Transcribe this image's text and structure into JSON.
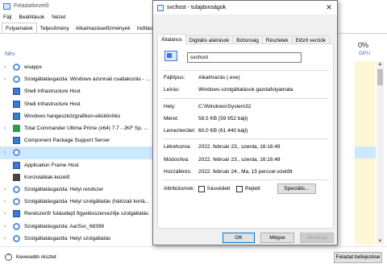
{
  "task_manager": {
    "title": "Feladatkezelő",
    "menu": [
      "Fájl",
      "Beállítások",
      "Nézet"
    ],
    "tabs": [
      "Folyamatok",
      "Teljesítmény",
      "Alkalmazáselőzmények",
      "Indítás"
    ],
    "name_header": "Név",
    "gpu_percent": "0%",
    "gpu_label": "GPU",
    "rows": [
      {
        "name": "wsappx",
        "chev": true,
        "icon": "gear-icon"
      },
      {
        "name": "Szolgáltatásgazda: Windows azonnali csatlakozás - ...",
        "chev": true,
        "icon": "gear-icon"
      },
      {
        "name": "Shell Infrastructure Host",
        "chev": false,
        "icon": "window-icon"
      },
      {
        "name": "Shell Infrastructure Host",
        "chev": false,
        "icon": "window-icon"
      },
      {
        "name": "Windows hangeszközgrafikon-elkülönítés",
        "chev": false,
        "icon": "window-icon"
      },
      {
        "name": "Total Commander Ultima Prime (x64) 7.7 - JKF Sp. ...",
        "chev": true,
        "icon": "app-icon"
      },
      {
        "name": "Component Package Support Server",
        "chev": false,
        "icon": "window-icon"
      },
      {
        "name": "",
        "chev": true,
        "icon": "gear-icon",
        "selected": true
      },
      {
        "name": "Application Frame Host",
        "chev": false,
        "icon": "window-icon"
      },
      {
        "name": "Konzolablak-kezelő",
        "chev": false,
        "icon": "console-icon"
      },
      {
        "name": "Szolgáltatásgazda: Helyi rendszer",
        "chev": true,
        "icon": "gear-icon"
      },
      {
        "name": "Szolgáltatásgazda: Helyi szolgáltatás (hálózati korlá...",
        "chev": true,
        "icon": "gear-icon"
      },
      {
        "name": "Rendszerőr futásidejű figyelésszervezője szolgáltatás",
        "chev": true,
        "icon": "window-icon"
      },
      {
        "name": "Szolgáltatásgazda: AarSvc_68398",
        "chev": true,
        "icon": "gear-icon"
      },
      {
        "name": "Szolgáltatásgazda: Helyi szolgáltatás",
        "chev": true,
        "icon": "gear-icon"
      }
    ],
    "fewer_details": "Kevesebb részlet",
    "end_task": "Feladat befejezése"
  },
  "dialog": {
    "title": "svchost - tulajdonságok",
    "tabs": [
      "Általános",
      "Digitális aláírások",
      "Biztonság",
      "Részletek",
      "Előző verziók"
    ],
    "file_name": "svchost",
    "file_type_label": "Fájltípus:",
    "file_type_value": "Alkalmazás (.exe)",
    "description_label": "Leírás:",
    "description_value": "Windows-szolgáltatások gazdafolyamata",
    "location_label": "Hely:",
    "location_value": "C:\\Windows\\System32",
    "size_label": "Méret:",
    "size_value": "58,5 KB (59 952 bájt)",
    "disk_size_label": "Lemezterület:",
    "disk_size_value": "60,0 KB (61 440 bájt)",
    "created_label": "Létrehozva:",
    "created_value": "2022. február 23., szerda, 16:16:49",
    "modified_label": "Módosítva:",
    "modified_value": "2022. február 23., szerda, 16:16:49",
    "accessed_label": "Hozzáférés:",
    "accessed_value": "2022. február 24., Ma, 15 perccel ezelőtt",
    "attributes_label": "Attribútumok:",
    "readonly_label": "Írásvédett",
    "hidden_label": "Rejtett",
    "advanced_button": "Speciális...",
    "ok_button": "OK",
    "cancel_button": "Mégse",
    "apply_button": "Alkalmaz"
  }
}
